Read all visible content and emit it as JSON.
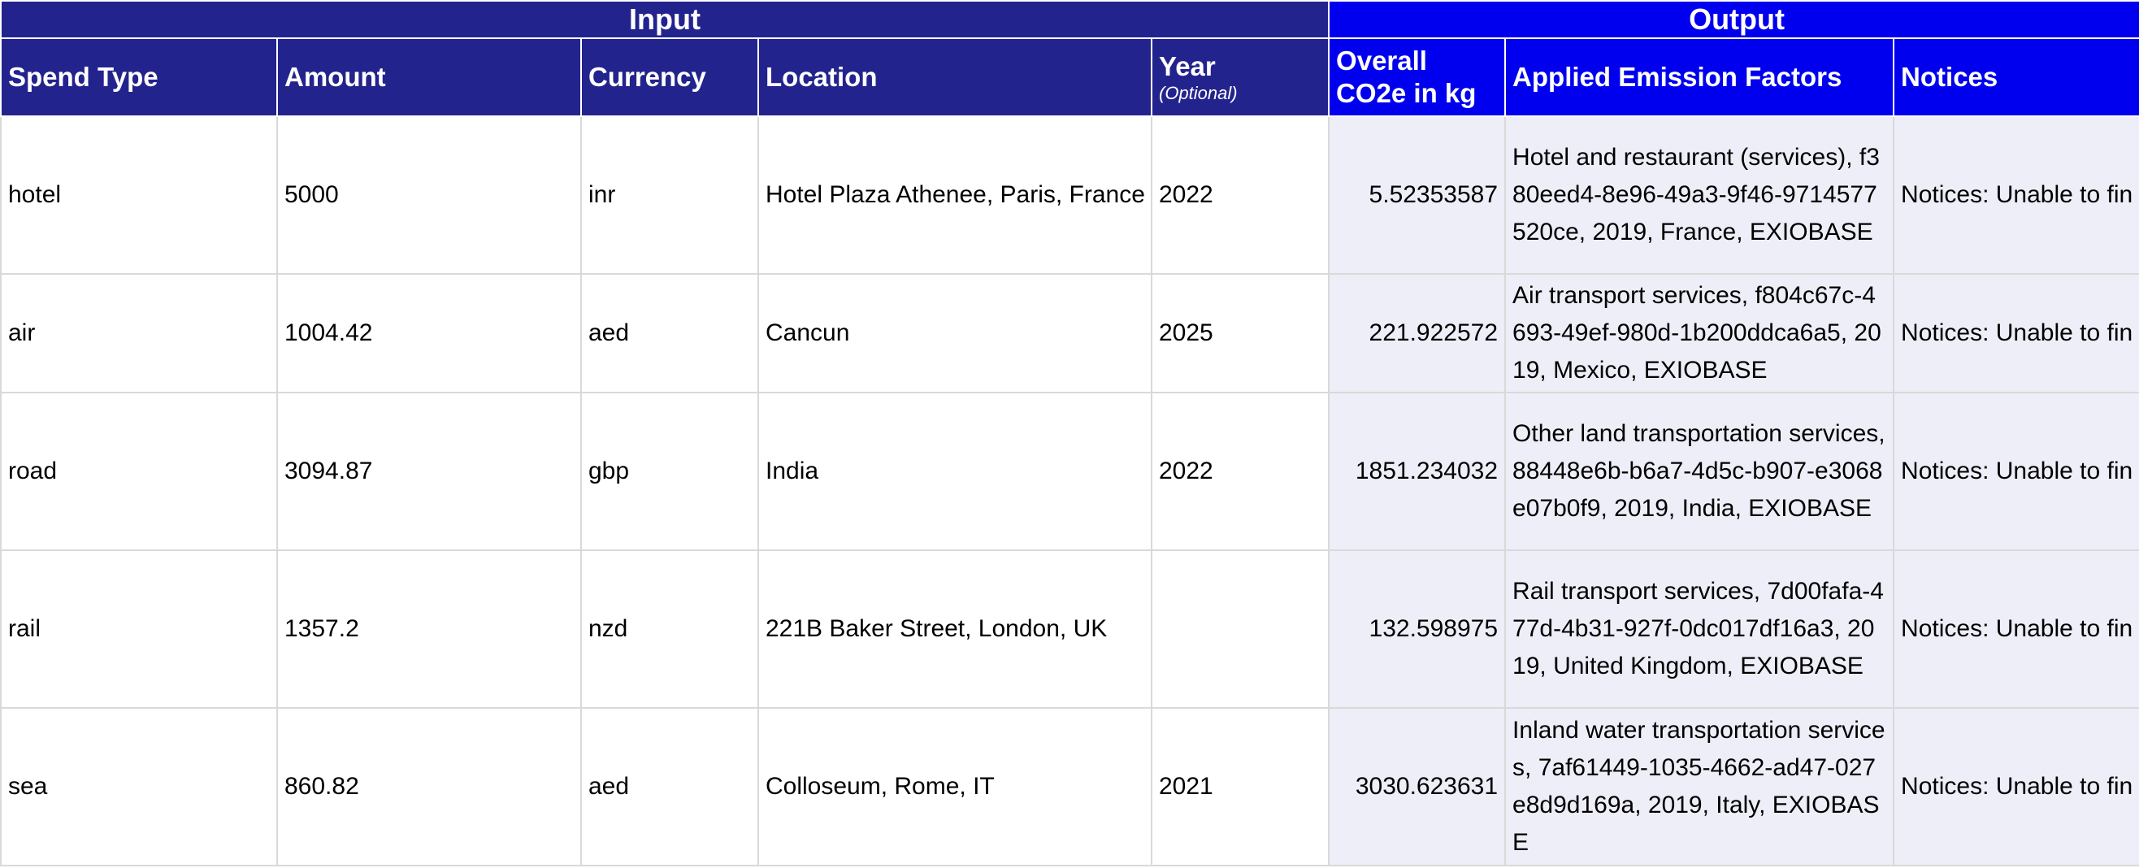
{
  "groups": {
    "input": "Input",
    "output": "Output"
  },
  "headers": {
    "spend_type": "Spend Type",
    "amount": "Amount",
    "currency": "Currency",
    "location": "Location",
    "year": "Year",
    "year_note": "(Optional)",
    "co2e": "Overall CO2e in kg",
    "factors": "Applied Emission Factors",
    "notices": "Notices"
  },
  "rows": [
    {
      "spend_type": "hotel",
      "amount": "5000",
      "currency": "inr",
      "location": "Hotel Plaza Athenee, Paris, France",
      "year": "2022",
      "co2e": "5.52353587",
      "factors": "Hotel and restaurant (services), f380eed4-8e96-49a3-9f46-9714577520ce, 2019, France, EXIOBASE",
      "notices": "Notices: Unable to fin"
    },
    {
      "spend_type": "air",
      "amount": "1004.42",
      "currency": "aed",
      "location": "Cancun",
      "year": "2025",
      "co2e": "221.922572",
      "factors": "Air transport services, f804c67c-4693-49ef-980d-1b200ddca6a5, 2019, Mexico, EXIOBASE",
      "notices": "Notices: Unable to fin"
    },
    {
      "spend_type": "road",
      "amount": "3094.87",
      "currency": "gbp",
      "location": "India",
      "year": "2022",
      "co2e": "1851.234032",
      "factors": "Other land transportation services, 88448e6b-b6a7-4d5c-b907-e3068e07b0f9, 2019, India, EXIOBASE",
      "notices": "Notices: Unable to fin"
    },
    {
      "spend_type": "rail",
      "amount": "1357.2",
      "currency": "nzd",
      "location": "221B Baker Street, London, UK",
      "year": "",
      "co2e": "132.598975",
      "factors": "Rail transport services, 7d00fafa-477d-4b31-927f-0dc017df16a3, 2019, United Kingdom, EXIOBASE",
      "notices": "Notices: Unable to fin"
    },
    {
      "spend_type": "sea",
      "amount": "860.82",
      "currency": "aed",
      "location": "Colloseum, Rome, IT",
      "year": "2021",
      "co2e": "3030.623631",
      "factors": "Inland water transportation services, 7af61449-1035-4662-ad47-027e8d9d169a, 2019, Italy, EXIOBASE",
      "notices": "Notices: Unable to fin"
    }
  ]
}
